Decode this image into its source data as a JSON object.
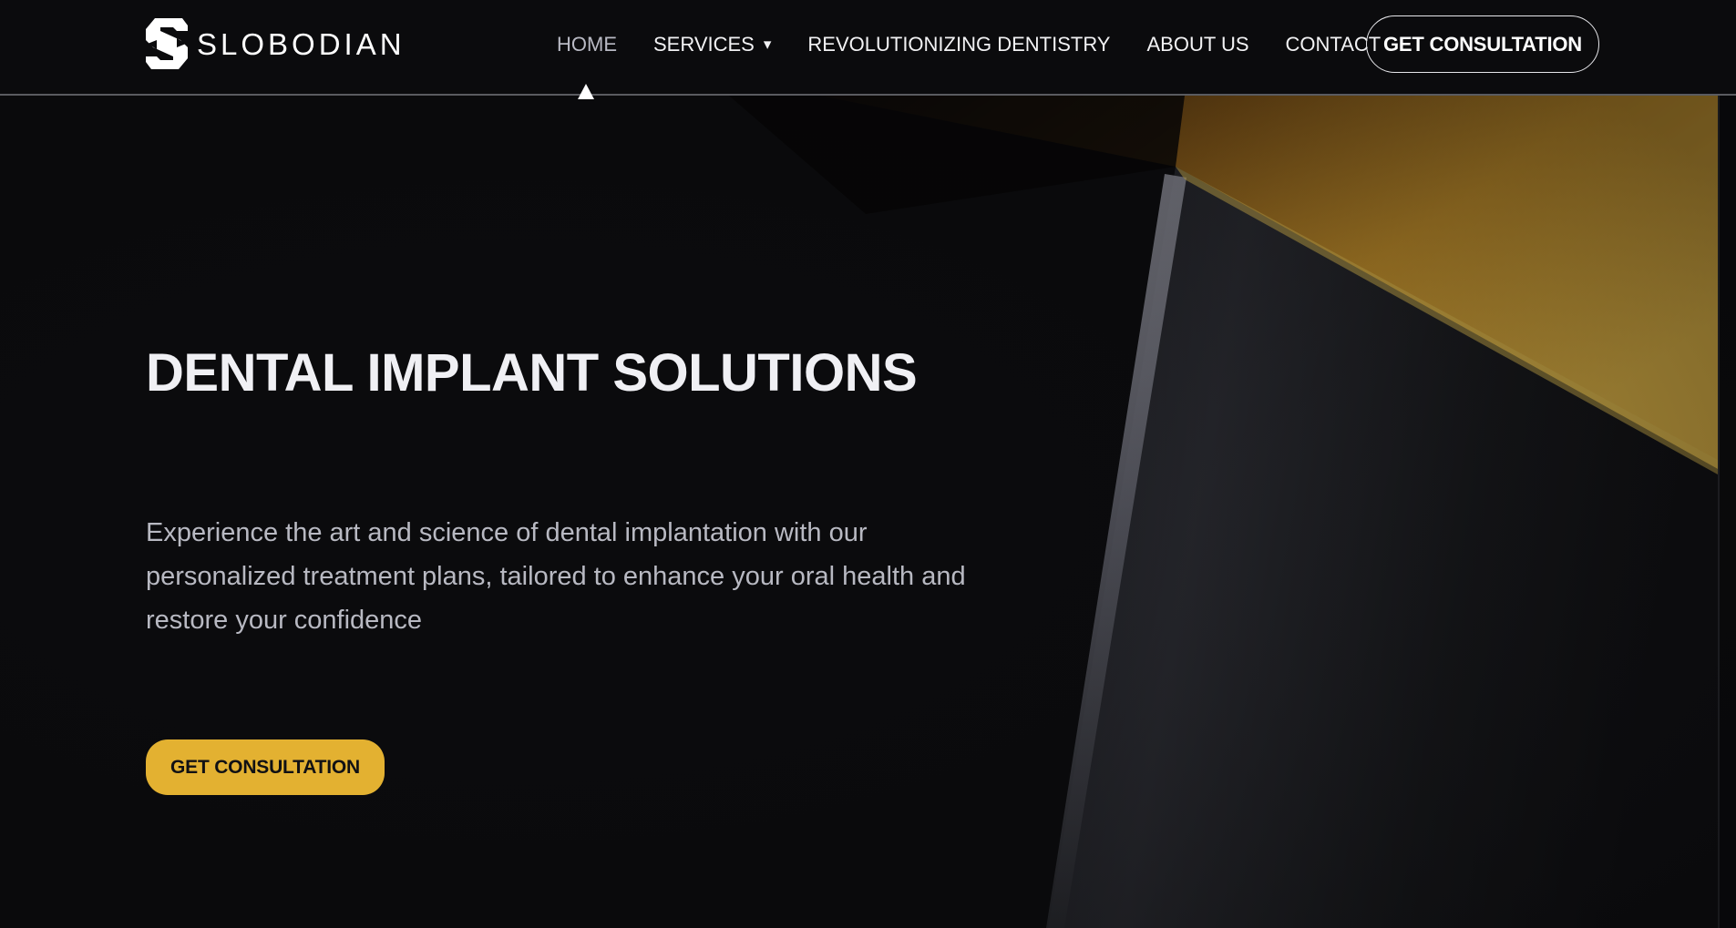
{
  "header": {
    "logo": {
      "icon": "slobodian-s-logo-icon",
      "text": "SLOBODIAN"
    },
    "nav": [
      {
        "label": "HOME",
        "active": true
      },
      {
        "label": "SERVICES",
        "has_dropdown": true,
        "dropdown_icon": "▾"
      },
      {
        "label": "REVOLUTIONIZING DENTISTRY"
      },
      {
        "label": "ABOUT US"
      },
      {
        "label": "CONTACT"
      }
    ],
    "cta_label": "GET CONSULTATION"
  },
  "hero": {
    "title": "DENTAL IMPLANT SOLUTIONS",
    "subtitle": "Experience the art and science of dental implantation with our personalized treatment plans, tailored to enhance your oral health and restore your confidence",
    "cta_label": "GET CONSULTATION"
  },
  "colors": {
    "background": "#0b0b0d",
    "accent_gold": "#e3b131",
    "text_primary": "#f0f0f4",
    "text_secondary": "#b8b9c2"
  }
}
